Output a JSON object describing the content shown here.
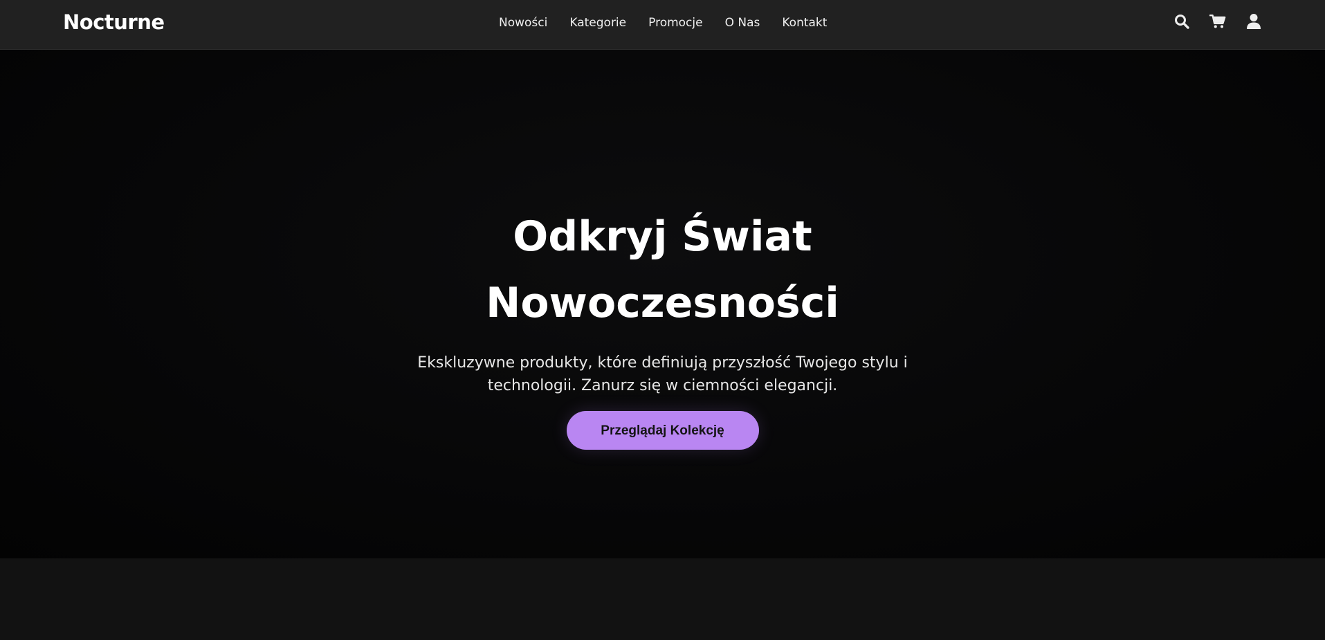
{
  "brand": {
    "name": "Nocturne"
  },
  "nav": {
    "items": [
      {
        "label": "Nowości"
      },
      {
        "label": "Kategorie"
      },
      {
        "label": "Promocje"
      },
      {
        "label": "O Nas"
      },
      {
        "label": "Kontakt"
      }
    ]
  },
  "header_icons": [
    "search-icon",
    "cart-icon",
    "user-icon"
  ],
  "hero": {
    "title": "Odkryj Świat Nowoczesności",
    "subtitle": "Ekskluzywne produkty, które definiują przyszłość Twojego stylu i technologii. Zanurz się w ciemności elegancji.",
    "cta_label": "Przeglądaj Kolekcję"
  },
  "colors": {
    "accent": "#b986f2",
    "header_bg": "#212121",
    "hero_bg": "#050505",
    "page_bg": "#121212"
  }
}
